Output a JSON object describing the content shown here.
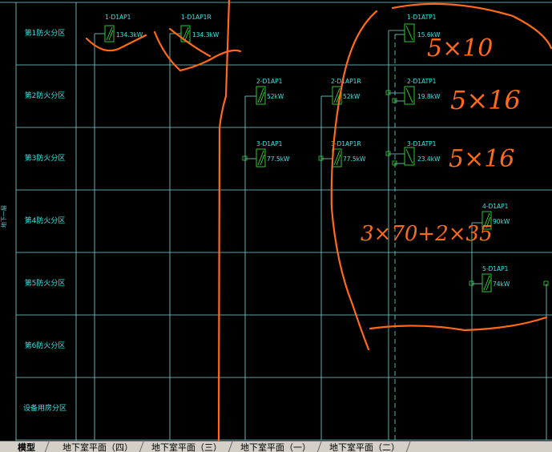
{
  "colors": {
    "background": "#000000",
    "grid": "#7ad7d7",
    "device_outline": "#33dd33",
    "text": "#3de3e3",
    "annotation": "#ff6a1a",
    "tabbar": "#d4d0c8"
  },
  "side_label": "地下一层",
  "rows": [
    "第1防火分区",
    "第2防火分区",
    "第3防火分区",
    "第4防火分区",
    "第5防火分区",
    "第6防火分区",
    "设备用房分区"
  ],
  "devices": [
    {
      "name": "1-D1AP1",
      "power": "134.3kW"
    },
    {
      "name": "1-D1AP1R",
      "power": "134.3kW"
    },
    {
      "name": "1-D1ATP1",
      "power": "15.6kW"
    },
    {
      "name": "2-D1AP1",
      "power": "52kW"
    },
    {
      "name": "2-D1AP1R",
      "power": "52kW"
    },
    {
      "name": "2-D1ATP1",
      "power": "19.8kW"
    },
    {
      "name": "3-D1AP1",
      "power": "77.5kW"
    },
    {
      "name": "3-D1AP1R",
      "power": "77.5kW"
    },
    {
      "name": "3-D1ATP1",
      "power": "23.4kW"
    },
    {
      "name": "4-D1AP1",
      "power": "90kW"
    },
    {
      "name": "5-D1AP1",
      "power": "74kW"
    }
  ],
  "annotations": [
    "5×10",
    "5×16",
    "5×16",
    "3×70+2×35"
  ],
  "tabs": [
    {
      "label": "模型",
      "active": true
    },
    {
      "label": "地下室平面（四）"
    },
    {
      "label": "地下室平面（三）"
    },
    {
      "label": "地下室平面（一）"
    },
    {
      "label": "地下室平面（二）"
    }
  ]
}
